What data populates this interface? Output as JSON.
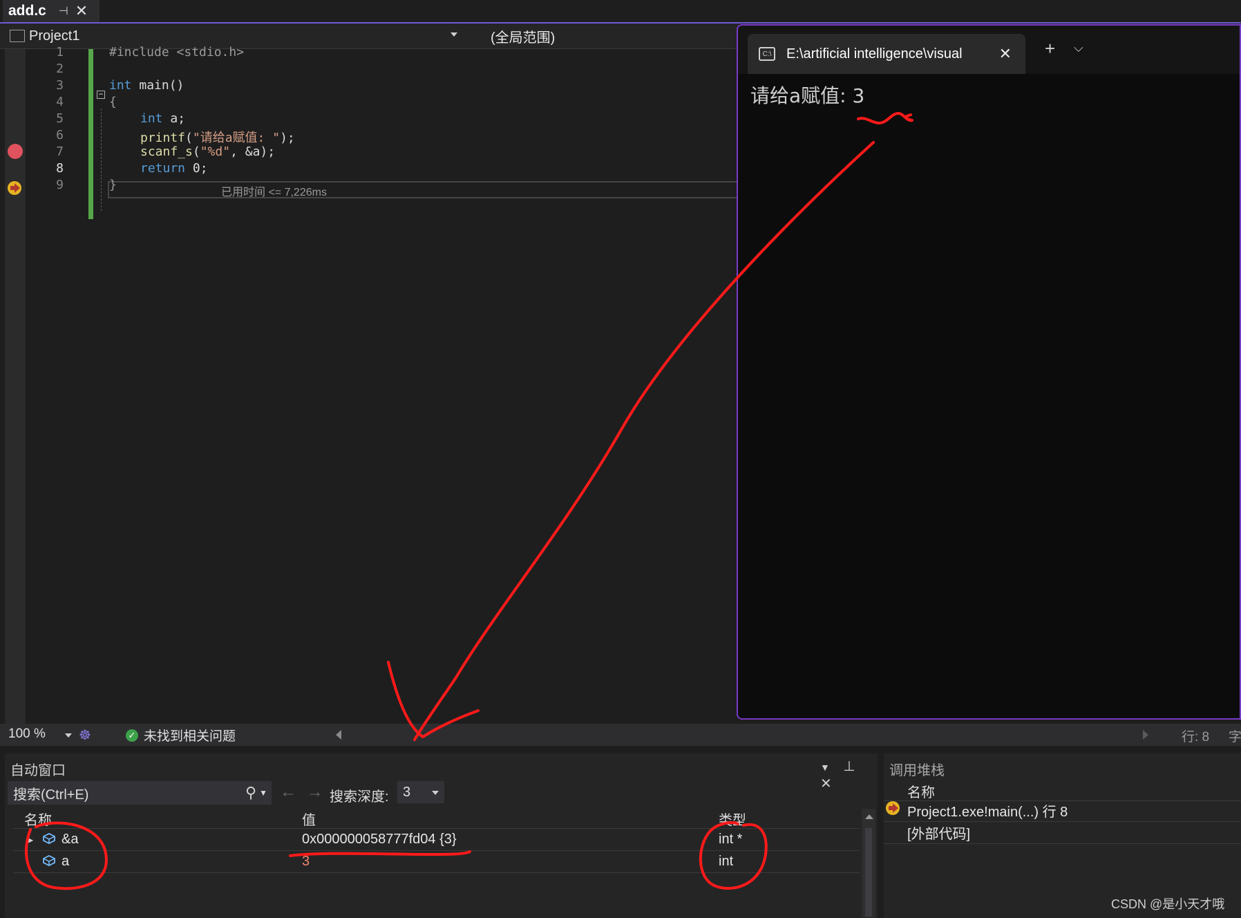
{
  "document_tab": {
    "name": "add.c",
    "pin_icon": "pin-icon",
    "close_icon": "close-icon"
  },
  "navbar": {
    "project": "Project1",
    "scope": "(全局范围)"
  },
  "editor": {
    "line_numbers": [
      "1",
      "2",
      "3",
      "4",
      "5",
      "6",
      "7",
      "8",
      "9"
    ],
    "current_line": "8",
    "lines": {
      "l1": "#include <stdio.h>",
      "l3_kw": "int",
      "l3_rest": " main()",
      "l4": "{",
      "l5_kw": "int",
      "l5_rest": " a;",
      "l6_fn": "printf",
      "l6_a": "(",
      "l6_str": "\"请给a赋值: \"",
      "l6_b": ");",
      "l7_fn": "scanf_s",
      "l7_a": "(",
      "l7_str": "\"%d\"",
      "l7_b": ", &a);",
      "l8_kw": "return",
      "l8_rest": " 0;",
      "l9": "}"
    },
    "perf_tip": "已用时间 <= 7,226ms",
    "breakpoint_line": "6"
  },
  "statusbar": {
    "zoom": "100 %",
    "issues": "未找到相关问题",
    "line": "行: 8",
    "char": "字"
  },
  "autos": {
    "title": "自动窗口",
    "search_placeholder": "搜索(Ctrl+E)",
    "depth_label": "搜索深度:",
    "depth_value": "3",
    "columns": [
      "名称",
      "值",
      "类型"
    ],
    "rows": [
      {
        "name": "&a",
        "value": "0x000000058777fd04 {3}",
        "type": "int *",
        "expandable": true
      },
      {
        "name": "a",
        "value": "3",
        "type": "int",
        "expandable": false
      }
    ]
  },
  "callstack": {
    "title": "调用堆栈",
    "column": "名称",
    "frames": [
      "Project1.exe!main(...) 行 8",
      "[外部代码]"
    ]
  },
  "console": {
    "tab_title": "E:\\artificial intelligence\\visual",
    "output": "请给a赋值: 3"
  },
  "watermark": "CSDN @是小天才哦",
  "colors": {
    "accent": "#6f5ad6",
    "annotation": "#ff1a1a",
    "console_border": "#7b3ac8",
    "changed_value": "#f48771"
  }
}
